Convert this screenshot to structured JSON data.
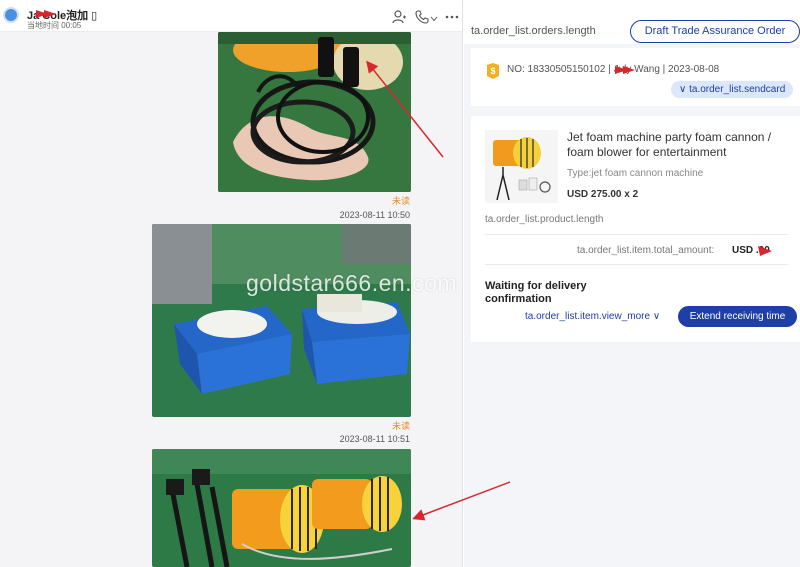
{
  "chat": {
    "contact_name": "Ja    Cole泡加 ▯",
    "contact_sub": "当地时间 00:05",
    "icons": [
      "add-contact-icon",
      "phone-icon",
      "more-icon"
    ],
    "messages": [
      {
        "status": "未读",
        "time": "2023-08-11 10:50"
      },
      {
        "status": "未读",
        "time": "2023-08-11 10:51"
      }
    ],
    "watermark": "goldstar666.en.com"
  },
  "order_panel": {
    "orders_length": "ta.order_list.orders.length",
    "draft_button": "Draft Trade Assurance Order",
    "order_no": "NO: 18330505150102   | July Wang | 2023-08-08",
    "sendcard": "∨ ta.order_list.sendcard",
    "product": {
      "title": "Jet foam machine party foam cannon / foam blower for entertainment",
      "type": "Type:jet foam cannon machine",
      "price": "USD 275.00 x 2"
    },
    "product_length": "ta.order_list.product.length",
    "total_label": "ta.order_list.item.total_amount:",
    "total_value": "USD    .00",
    "status": "Waiting for delivery confirmation",
    "view_more": "ta.order_list.item.view_more ∨",
    "extend_button": "Extend receiving time"
  },
  "colors": {
    "accent_blue": "#1e3fa6",
    "unread_orange": "#e48b1f",
    "annotation_red": "#d9262c"
  }
}
